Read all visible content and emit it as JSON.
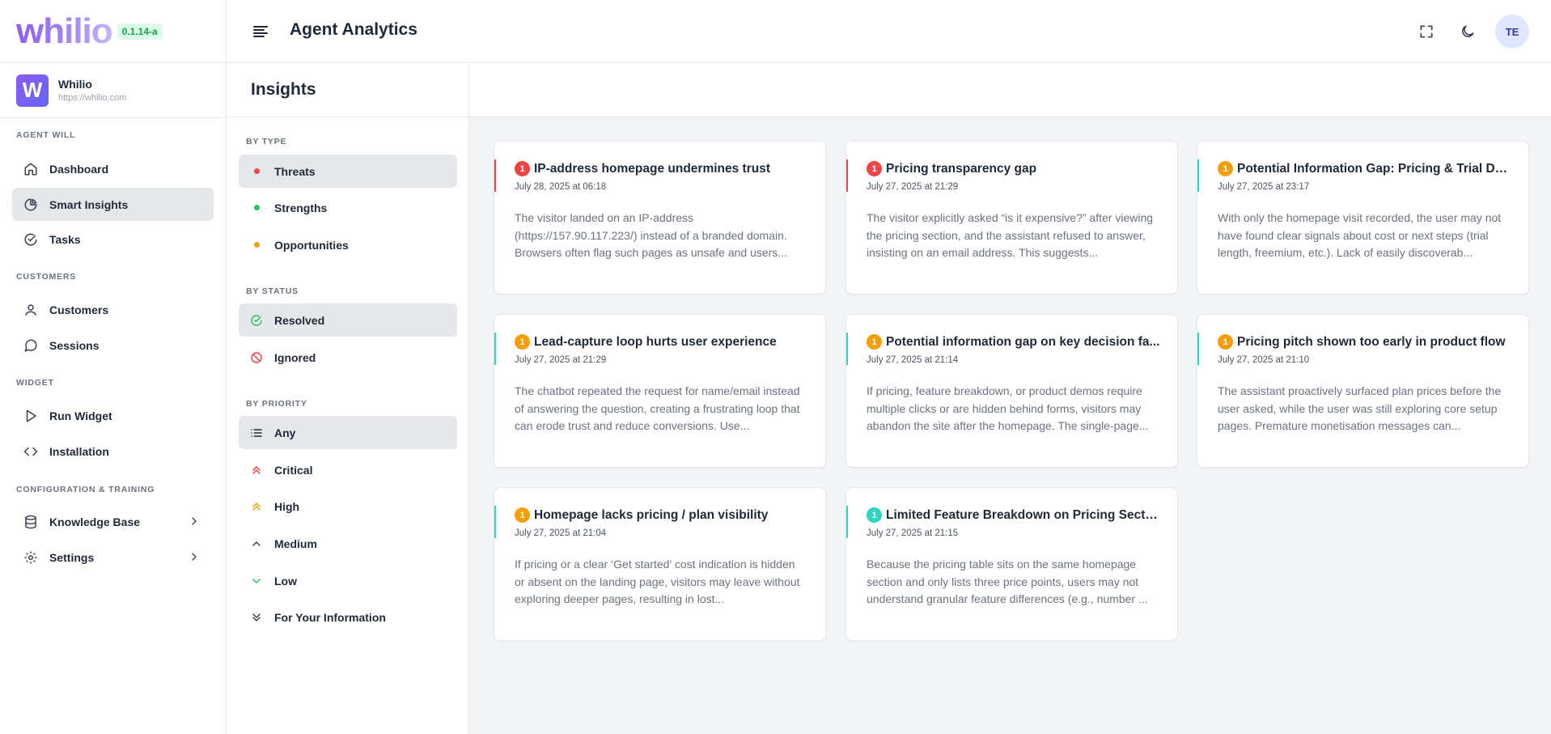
{
  "brand": {
    "logo": "whilio",
    "version": "0.1.14-a"
  },
  "site": {
    "initial": "W",
    "name": "Whilio",
    "url": "https://whilio.com"
  },
  "sidebar": {
    "sections": [
      "AGENT WILL",
      "CUSTOMERS",
      "WIDGET",
      "CONFIGURATION & TRAINING"
    ],
    "items": [
      {
        "label": "Dashboard",
        "icon": "home-icon"
      },
      {
        "label": "Smart Insights",
        "icon": "pie-chart-icon",
        "active": true
      },
      {
        "label": "Tasks",
        "icon": "check-circle-icon"
      },
      {
        "label": "Customers",
        "icon": "user-icon"
      },
      {
        "label": "Sessions",
        "icon": "chat-bubble-icon"
      },
      {
        "label": "Run Widget",
        "icon": "play-icon"
      },
      {
        "label": "Installation",
        "icon": "code-icon"
      },
      {
        "label": "Knowledge Base",
        "icon": "database-icon"
      },
      {
        "label": "Settings",
        "icon": "gear-icon"
      }
    ]
  },
  "header": {
    "title": "Agent Analytics",
    "user_initials": "TE"
  },
  "filters": {
    "title": "Insights",
    "by_type_label": "BY TYPE",
    "types": [
      "Threats",
      "Strengths",
      "Opportunities"
    ],
    "by_status_label": "BY STATUS",
    "statuses": [
      "Resolved",
      "Ignored"
    ],
    "by_priority_label": "BY PRIORITY",
    "priorities": [
      "Any",
      "Critical",
      "High",
      "Medium",
      "Low",
      "For Your Information"
    ]
  },
  "colors": {
    "red": "#ef4444",
    "orange": "#f59e0b",
    "teal": "#2dd4bf",
    "green": "#22c55e",
    "accent": "#8b5cf6"
  },
  "cards": [
    {
      "badge": "1",
      "badge_color": "#ef4444",
      "accent": "#ef4444",
      "title": "IP-address homepage undermines trust",
      "date": "July 28, 2025 at 06:18",
      "desc": "The visitor landed on an IP-address (https://157.90.117.223/) instead of a branded domain. Browsers often flag such pages as unsafe and users..."
    },
    {
      "badge": "1",
      "badge_color": "#ef4444",
      "accent": "#ef4444",
      "title": "Pricing transparency gap",
      "date": "July 27, 2025 at 21:29",
      "desc": "The visitor explicitly asked “is it expensive?” after viewing the pricing section, and the assistant refused to answer, insisting on an email address. This suggests..."
    },
    {
      "badge": "1",
      "badge_color": "#f59e0b",
      "accent": "#2dd4bf",
      "title": "Potential Information Gap: Pricing & Trial De...",
      "date": "July 27, 2025 at 23:17",
      "desc": "With only the homepage visit recorded, the user may not have found clear signals about cost or next steps (trial length, freemium, etc.). Lack of easily discoverab..."
    },
    {
      "badge": "1",
      "badge_color": "#f59e0b",
      "accent": "#2dd4bf",
      "title": "Lead-capture loop hurts user experience",
      "date": "July 27, 2025 at 21:29",
      "desc": "The chatbot repeated the request for name/email instead of answering the question, creating a frustrating loop that can erode trust and reduce conversions. Use..."
    },
    {
      "badge": "1",
      "badge_color": "#f59e0b",
      "accent": "#2dd4bf",
      "title": "Potential information gap on key decision fa...",
      "date": "July 27, 2025 at 21:14",
      "desc": "If pricing, feature breakdown, or product demos require multiple clicks or are hidden behind forms, visitors may abandon the site after the homepage. The single-page..."
    },
    {
      "badge": "1",
      "badge_color": "#f59e0b",
      "accent": "#2dd4bf",
      "title": "Pricing pitch shown too early in product flow",
      "date": "July 27, 2025 at 21:10",
      "desc": "The assistant proactively surfaced plan prices before the user asked, while the user was still exploring core setup pages. Premature monetisation messages can..."
    },
    {
      "badge": "1",
      "badge_color": "#f59e0b",
      "accent": "#2dd4bf",
      "title": "Homepage lacks pricing / plan visibility",
      "date": "July 27, 2025 at 21:04",
      "desc": "If pricing or a clear ‘Get started’ cost indication is hidden or absent on the landing page, visitors may leave without exploring deeper pages, resulting in lost..."
    },
    {
      "badge": "1",
      "badge_color": "#2dd4bf",
      "accent": "#2dd4bf",
      "title": "Limited Feature Breakdown on Pricing Section",
      "date": "July 27, 2025 at 21:15",
      "desc": "Because the pricing table sits on the same homepage section and only lists three price points, users may not understand granular feature differences (e.g., number ..."
    }
  ]
}
